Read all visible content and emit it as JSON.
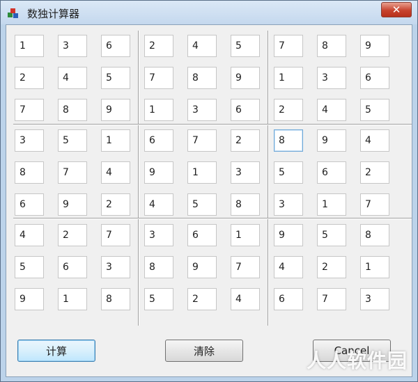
{
  "window": {
    "title": "数独计算器",
    "close_label": "✕"
  },
  "grid": [
    [
      "1",
      "3",
      "6",
      "2",
      "4",
      "5",
      "7",
      "8",
      "9"
    ],
    [
      "2",
      "4",
      "5",
      "7",
      "8",
      "9",
      "1",
      "3",
      "6"
    ],
    [
      "7",
      "8",
      "9",
      "1",
      "3",
      "6",
      "2",
      "4",
      "5"
    ],
    [
      "3",
      "5",
      "1",
      "6",
      "7",
      "2",
      "8",
      "9",
      "4"
    ],
    [
      "8",
      "7",
      "4",
      "9",
      "1",
      "3",
      "5",
      "6",
      "2"
    ],
    [
      "6",
      "9",
      "2",
      "4",
      "5",
      "8",
      "3",
      "1",
      "7"
    ],
    [
      "4",
      "2",
      "7",
      "3",
      "6",
      "1",
      "9",
      "5",
      "8"
    ],
    [
      "5",
      "6",
      "3",
      "8",
      "9",
      "7",
      "4",
      "2",
      "1"
    ],
    [
      "9",
      "1",
      "8",
      "5",
      "2",
      "4",
      "6",
      "7",
      "3"
    ]
  ],
  "focused_cell": [
    3,
    6
  ],
  "buttons": {
    "calculate": "计算",
    "clear": "清除",
    "cancel": "Cancel"
  },
  "watermark": "人人软件园",
  "icons": {
    "app": "app-icon",
    "close": "close-icon"
  },
  "colors": {
    "titlebar": "#c4d8ee",
    "close_button": "#c7432e",
    "client_bg": "#f0f0f0"
  }
}
